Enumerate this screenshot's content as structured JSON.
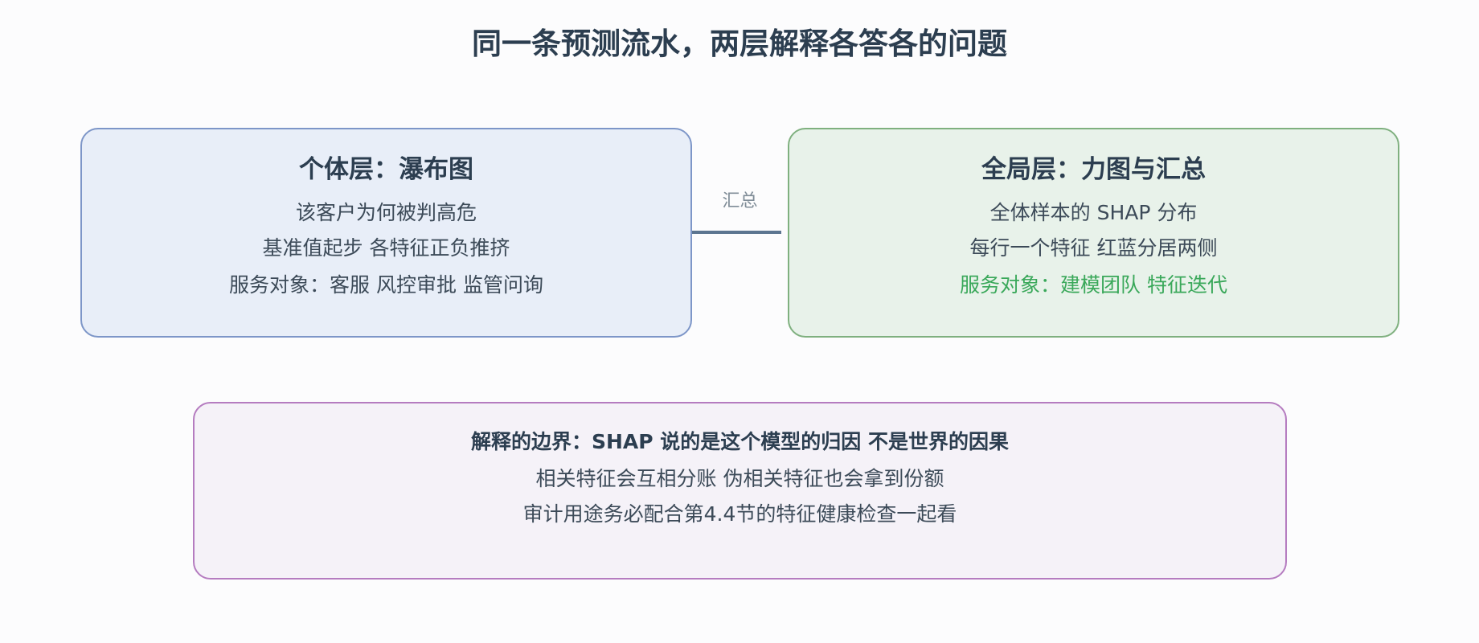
{
  "title": "同一条预测流水，两层解释各答各的问题",
  "individual": {
    "heading": "个体层：瀑布图",
    "lines": [
      "该客户为何被判高危",
      "基准值起步 各特征正负推挤"
    ],
    "service": "服务对象：客服 风控审批 监管问询"
  },
  "connector": {
    "label": "汇总"
  },
  "global": {
    "heading": "全局层：力图与汇总",
    "lines": [
      "全体样本的 SHAP 分布",
      "每行一个特征 红蓝分居两侧"
    ],
    "service": "服务对象：建模团队 特征迭代"
  },
  "boundary": {
    "heading": "解释的边界：SHAP 说的是这个模型的归因 不是世界的因果",
    "lines": [
      "相关特征会互相分账 伪相关特征也会拿到份额",
      "审计用途务必配合第4.4节的特征健康检查一起看"
    ]
  },
  "colors": {
    "individual_fill": "#e8eef8",
    "individual_border": "#7d96c8",
    "global_fill": "#e8f2ea",
    "global_border": "#7fb07f",
    "global_service_text": "#3aa85a",
    "boundary_fill": "#f5f2f8",
    "boundary_border": "#b57cc0",
    "connector": "#5c7590"
  }
}
